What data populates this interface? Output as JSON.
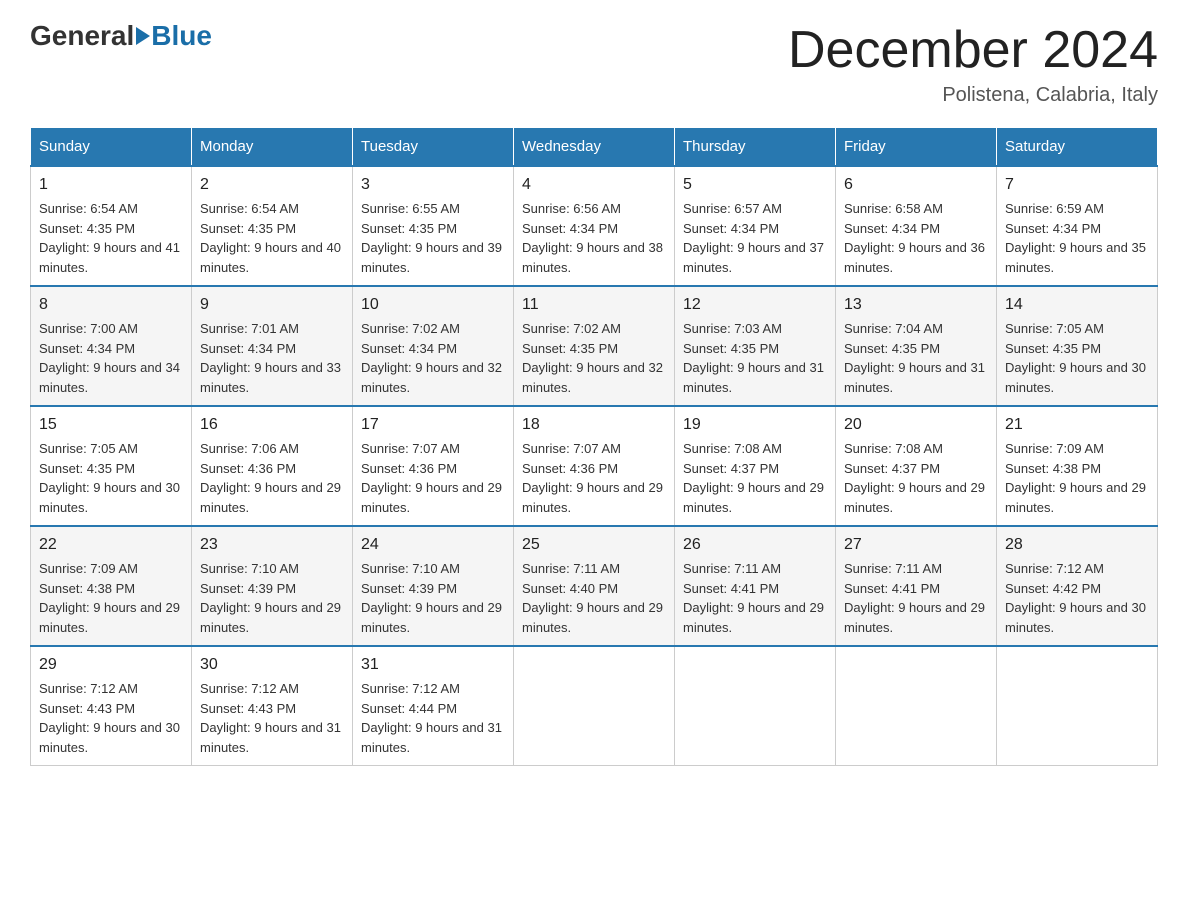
{
  "header": {
    "logo_general": "General",
    "logo_blue": "Blue",
    "month_title": "December 2024",
    "location": "Polistena, Calabria, Italy"
  },
  "days_of_week": [
    "Sunday",
    "Monday",
    "Tuesday",
    "Wednesday",
    "Thursday",
    "Friday",
    "Saturday"
  ],
  "weeks": [
    [
      {
        "day": "1",
        "sunrise": "6:54 AM",
        "sunset": "4:35 PM",
        "daylight": "9 hours and 41 minutes."
      },
      {
        "day": "2",
        "sunrise": "6:54 AM",
        "sunset": "4:35 PM",
        "daylight": "9 hours and 40 minutes."
      },
      {
        "day": "3",
        "sunrise": "6:55 AM",
        "sunset": "4:35 PM",
        "daylight": "9 hours and 39 minutes."
      },
      {
        "day": "4",
        "sunrise": "6:56 AM",
        "sunset": "4:34 PM",
        "daylight": "9 hours and 38 minutes."
      },
      {
        "day": "5",
        "sunrise": "6:57 AM",
        "sunset": "4:34 PM",
        "daylight": "9 hours and 37 minutes."
      },
      {
        "day": "6",
        "sunrise": "6:58 AM",
        "sunset": "4:34 PM",
        "daylight": "9 hours and 36 minutes."
      },
      {
        "day": "7",
        "sunrise": "6:59 AM",
        "sunset": "4:34 PM",
        "daylight": "9 hours and 35 minutes."
      }
    ],
    [
      {
        "day": "8",
        "sunrise": "7:00 AM",
        "sunset": "4:34 PM",
        "daylight": "9 hours and 34 minutes."
      },
      {
        "day": "9",
        "sunrise": "7:01 AM",
        "sunset": "4:34 PM",
        "daylight": "9 hours and 33 minutes."
      },
      {
        "day": "10",
        "sunrise": "7:02 AM",
        "sunset": "4:34 PM",
        "daylight": "9 hours and 32 minutes."
      },
      {
        "day": "11",
        "sunrise": "7:02 AM",
        "sunset": "4:35 PM",
        "daylight": "9 hours and 32 minutes."
      },
      {
        "day": "12",
        "sunrise": "7:03 AM",
        "sunset": "4:35 PM",
        "daylight": "9 hours and 31 minutes."
      },
      {
        "day": "13",
        "sunrise": "7:04 AM",
        "sunset": "4:35 PM",
        "daylight": "9 hours and 31 minutes."
      },
      {
        "day": "14",
        "sunrise": "7:05 AM",
        "sunset": "4:35 PM",
        "daylight": "9 hours and 30 minutes."
      }
    ],
    [
      {
        "day": "15",
        "sunrise": "7:05 AM",
        "sunset": "4:35 PM",
        "daylight": "9 hours and 30 minutes."
      },
      {
        "day": "16",
        "sunrise": "7:06 AM",
        "sunset": "4:36 PM",
        "daylight": "9 hours and 29 minutes."
      },
      {
        "day": "17",
        "sunrise": "7:07 AM",
        "sunset": "4:36 PM",
        "daylight": "9 hours and 29 minutes."
      },
      {
        "day": "18",
        "sunrise": "7:07 AM",
        "sunset": "4:36 PM",
        "daylight": "9 hours and 29 minutes."
      },
      {
        "day": "19",
        "sunrise": "7:08 AM",
        "sunset": "4:37 PM",
        "daylight": "9 hours and 29 minutes."
      },
      {
        "day": "20",
        "sunrise": "7:08 AM",
        "sunset": "4:37 PM",
        "daylight": "9 hours and 29 minutes."
      },
      {
        "day": "21",
        "sunrise": "7:09 AM",
        "sunset": "4:38 PM",
        "daylight": "9 hours and 29 minutes."
      }
    ],
    [
      {
        "day": "22",
        "sunrise": "7:09 AM",
        "sunset": "4:38 PM",
        "daylight": "9 hours and 29 minutes."
      },
      {
        "day": "23",
        "sunrise": "7:10 AM",
        "sunset": "4:39 PM",
        "daylight": "9 hours and 29 minutes."
      },
      {
        "day": "24",
        "sunrise": "7:10 AM",
        "sunset": "4:39 PM",
        "daylight": "9 hours and 29 minutes."
      },
      {
        "day": "25",
        "sunrise": "7:11 AM",
        "sunset": "4:40 PM",
        "daylight": "9 hours and 29 minutes."
      },
      {
        "day": "26",
        "sunrise": "7:11 AM",
        "sunset": "4:41 PM",
        "daylight": "9 hours and 29 minutes."
      },
      {
        "day": "27",
        "sunrise": "7:11 AM",
        "sunset": "4:41 PM",
        "daylight": "9 hours and 29 minutes."
      },
      {
        "day": "28",
        "sunrise": "7:12 AM",
        "sunset": "4:42 PM",
        "daylight": "9 hours and 30 minutes."
      }
    ],
    [
      {
        "day": "29",
        "sunrise": "7:12 AM",
        "sunset": "4:43 PM",
        "daylight": "9 hours and 30 minutes."
      },
      {
        "day": "30",
        "sunrise": "7:12 AM",
        "sunset": "4:43 PM",
        "daylight": "9 hours and 31 minutes."
      },
      {
        "day": "31",
        "sunrise": "7:12 AM",
        "sunset": "4:44 PM",
        "daylight": "9 hours and 31 minutes."
      },
      null,
      null,
      null,
      null
    ]
  ],
  "labels": {
    "sunrise_prefix": "Sunrise: ",
    "sunset_prefix": "Sunset: ",
    "daylight_prefix": "Daylight: "
  }
}
